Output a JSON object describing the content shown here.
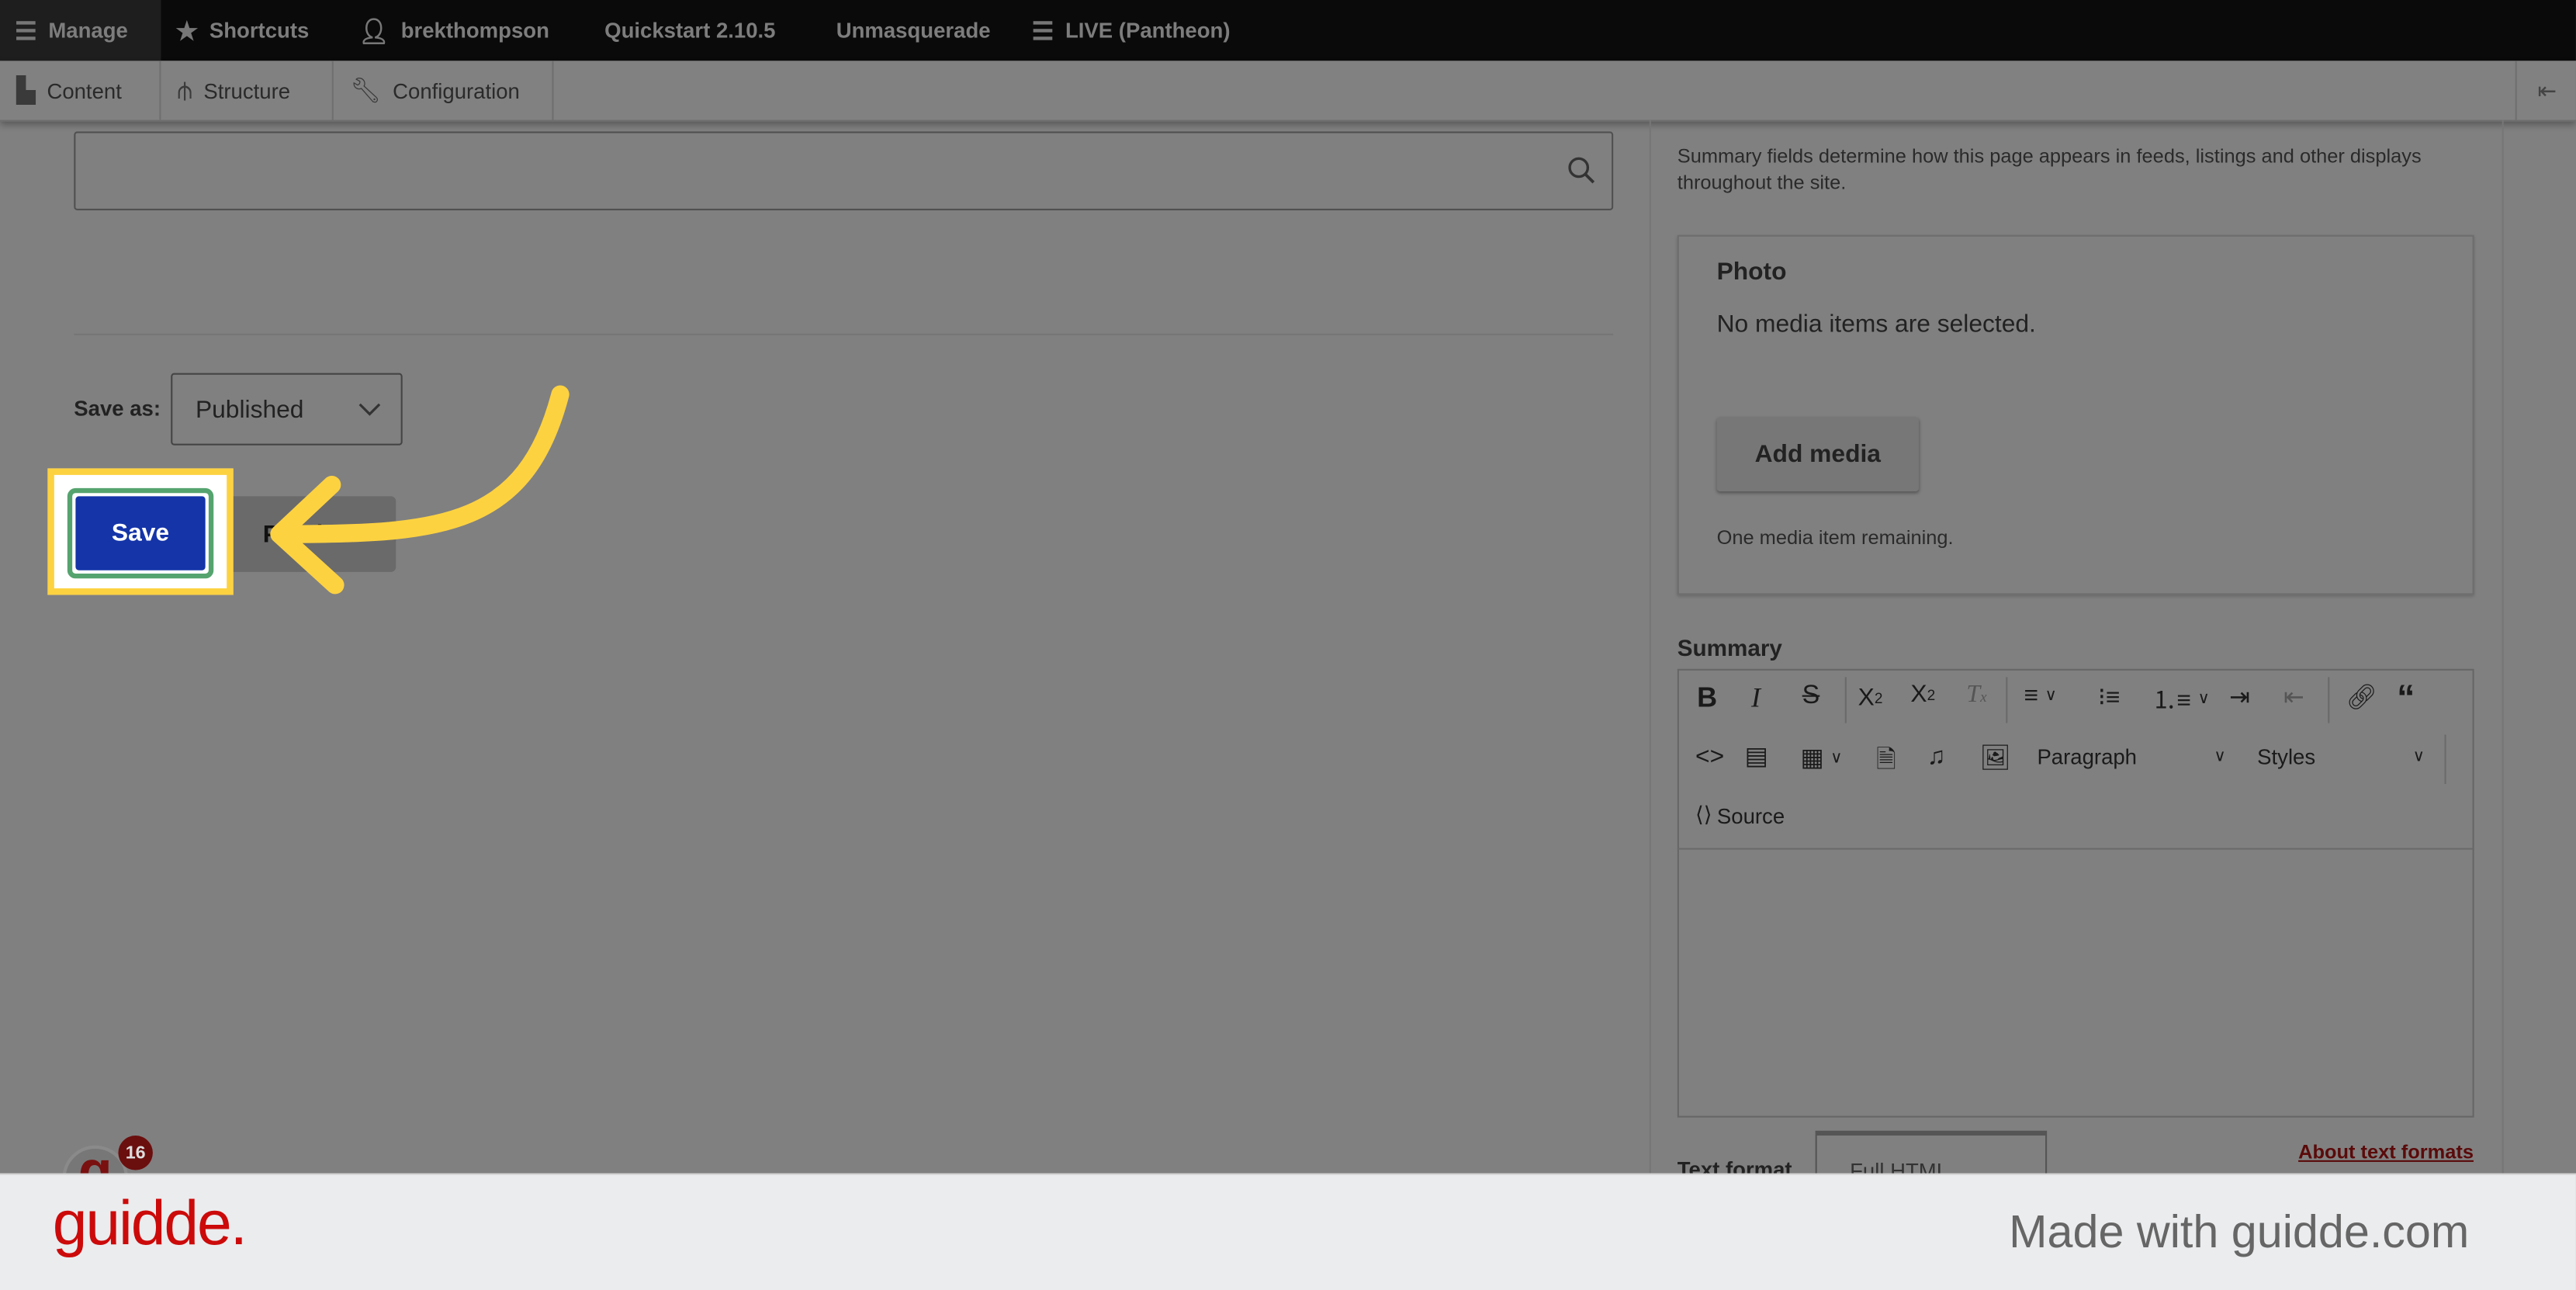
{
  "toolbar": {
    "manage": "Manage",
    "shortcuts": "Shortcuts",
    "user": "brekthompson",
    "quickstart": "Quickstart 2.10.5",
    "unmasquerade": "Unmasquerade",
    "environment": "LIVE (Pantheon)"
  },
  "admin_menu": {
    "items": [
      {
        "label": "Content",
        "icon": "file-icon"
      },
      {
        "label": "Structure",
        "icon": "sitemap-icon"
      },
      {
        "label": "Configuration",
        "icon": "wrench-icon"
      }
    ]
  },
  "main": {
    "save_as_label": "Save as:",
    "save_as_value": "Published",
    "save_button": "Save",
    "preview_button": "Preview"
  },
  "sidebar": {
    "summary_description": "Summary fields determine how this page appears in feeds, listings and other displays throughout the site.",
    "photo": {
      "title": "Photo",
      "empty_text": "No media items are selected.",
      "add_button": "Add media",
      "remaining": "One media item remaining."
    },
    "summary": {
      "label": "Summary",
      "paragraph_select": "Paragraph",
      "styles_select": "Styles",
      "source_button": "Source"
    },
    "text_format_label": "Text format",
    "text_format_value": "Full HTML",
    "about_link": "About text formats"
  },
  "widget": {
    "badge_count": "16"
  },
  "footer": {
    "logo": "guidde.",
    "made_with": "Made with guidde.com"
  },
  "colors": {
    "save_blue": "#1434a8",
    "highlight_yellow": "#fdd241",
    "guidde_red": "#cc0a0a"
  }
}
